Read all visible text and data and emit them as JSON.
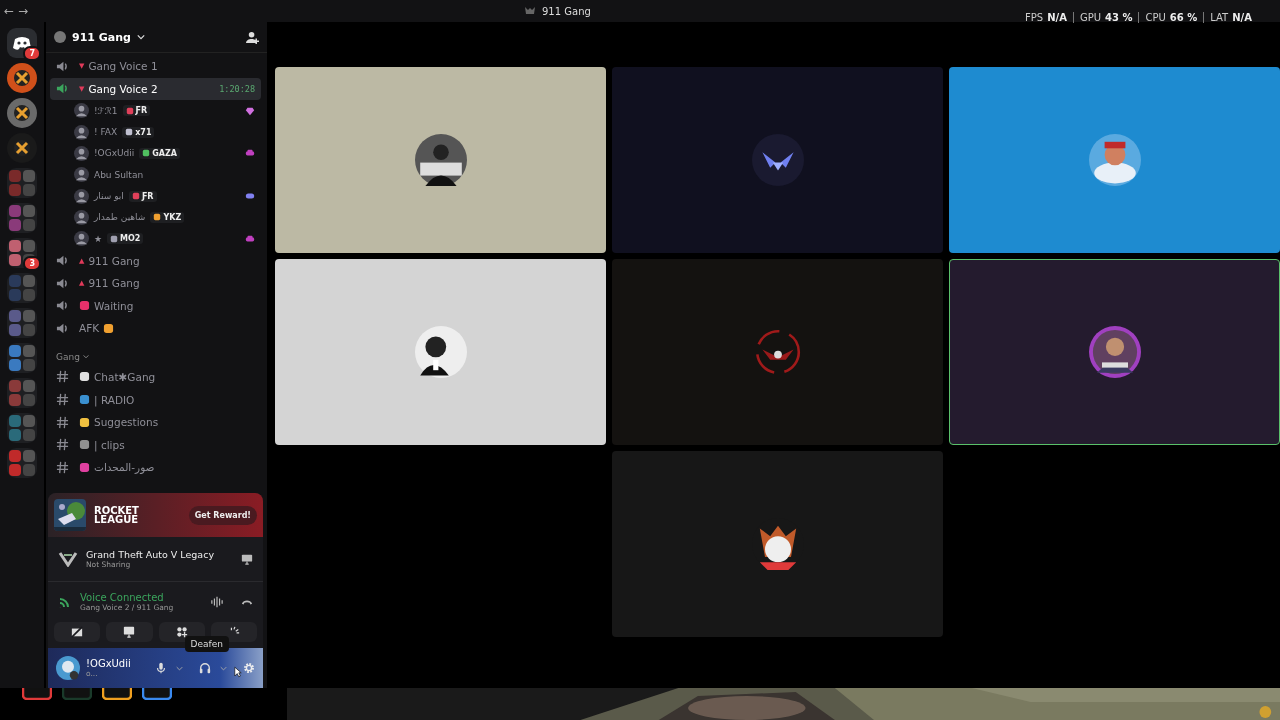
{
  "window": {
    "title": "911 Gang",
    "nav": [
      "←",
      "→"
    ]
  },
  "overlay": {
    "stats": [
      {
        "label": "FPS",
        "value": "N/A"
      },
      {
        "label": "GPU",
        "value": "43 %"
      },
      {
        "label": "CPU",
        "value": "66 %"
      },
      {
        "label": "LAT",
        "value": "N/A"
      }
    ]
  },
  "servers": [
    {
      "kind": "home",
      "badge": "7",
      "color": "#2b2d31"
    },
    {
      "kind": "server",
      "color": "#d0501a"
    },
    {
      "kind": "server",
      "color": "#6a6a6a"
    },
    {
      "kind": "server",
      "color": "#1a1a1a"
    },
    {
      "kind": "folder",
      "color": "#7a2a2a"
    },
    {
      "kind": "folder",
      "color": "#8a3a7a"
    },
    {
      "kind": "folder",
      "color": "#c06070",
      "badge": "3"
    },
    {
      "kind": "folder",
      "color": "#2a3a5a"
    },
    {
      "kind": "folder",
      "color": "#5a5a8a"
    },
    {
      "kind": "folder",
      "color": "#3a7ac0"
    },
    {
      "kind": "folder",
      "color": "#8a3a3a"
    },
    {
      "kind": "folder",
      "color": "#2a6a7a"
    },
    {
      "kind": "folder",
      "color": "#c02a2a"
    }
  ],
  "server_header": {
    "name": "911 Gang"
  },
  "channels": [
    {
      "kind": "voice",
      "marker": "▼",
      "name": "Gang Voice 1",
      "selected": false
    },
    {
      "kind": "voice",
      "marker": "▼",
      "name": "Gang Voice 2",
      "selected": true,
      "timer": "1:20:28",
      "children": [
        {
          "name": "!ℱℛ1",
          "tag": {
            "text": "ƑR",
            "color": "#e0405a"
          },
          "activity": {
            "kind": "gem",
            "color": "#d070e0"
          }
        },
        {
          "name": "! FAX",
          "tag": {
            "text": "x71",
            "color": "#c0c0d0"
          }
        },
        {
          "name": "!OGxUdii",
          "tag": {
            "text": "GAZA",
            "color": "#50c060"
          },
          "activity": {
            "kind": "couch",
            "color": "#c040c0"
          }
        },
        {
          "name": "Abu Sultan"
        },
        {
          "name": "ابو سنار",
          "tag": {
            "text": "ƑR",
            "color": "#e0405a"
          },
          "activity": {
            "kind": "gamepad",
            "color": "#8080f0"
          }
        },
        {
          "name": "شاهين طمدار",
          "tag": {
            "text": "YKZ",
            "color": "#f0a030"
          }
        },
        {
          "name": "★",
          "tag": {
            "text": "MO2",
            "color": "#a0a0b0"
          },
          "activity": {
            "kind": "couch",
            "color": "#c040c0"
          }
        }
      ]
    },
    {
      "kind": "voice",
      "marker": "▲",
      "name": "911 Gang",
      "selected": false
    },
    {
      "kind": "voice",
      "marker": "▲",
      "name": "911 Gang",
      "selected": false
    },
    {
      "kind": "voice",
      "color": "#e8306a",
      "name": "Waiting",
      "selected": false
    },
    {
      "kind": "voice",
      "color": "#f0a030",
      "emoji_after": true,
      "name": "AFK",
      "selected": false
    },
    {
      "kind": "category",
      "name": "Gang",
      "expanded": true
    },
    {
      "kind": "text",
      "color": "#e0e0e0",
      "name": "Chat✱Gang"
    },
    {
      "kind": "text",
      "color": "#3a90d0",
      "name": "| RADIO"
    },
    {
      "kind": "text",
      "color": "#f0c040",
      "name": "Suggestions"
    },
    {
      "kind": "text",
      "color": "#909090",
      "name": "| clips"
    },
    {
      "kind": "text",
      "color": "#e040a0",
      "name": "صور-المحدات"
    }
  ],
  "promo": {
    "title_lines": [
      "ROCKET",
      "LEAGUE"
    ],
    "button": "Get Reward!"
  },
  "activity": {
    "game": "Grand Theft Auto V Legacy",
    "status": "Not Sharing"
  },
  "voice": {
    "status": "Voice Connected",
    "channel": "Gang Voice 2 / 911 Gang"
  },
  "tooltip": "Deafen",
  "user": {
    "name": "!OGxUdii",
    "status": "o..."
  },
  "dock": [
    {
      "color": "#e03a3a"
    },
    {
      "color": "#1a3a2a"
    },
    {
      "color": "#f0a020"
    },
    {
      "color": "#3a8af0"
    }
  ],
  "tiles": [
    {
      "color": "#bcb9a4",
      "speaking": false
    },
    {
      "color": "#10101f",
      "speaking": false
    },
    {
      "color": "#1e8bd0",
      "speaking": false
    },
    {
      "color": "#d4d4d4",
      "speaking": false
    },
    {
      "color": "#141210",
      "speaking": false
    },
    {
      "color": "#241b2e",
      "speaking": true
    },
    {
      "color": "#171717",
      "speaking": false
    }
  ]
}
